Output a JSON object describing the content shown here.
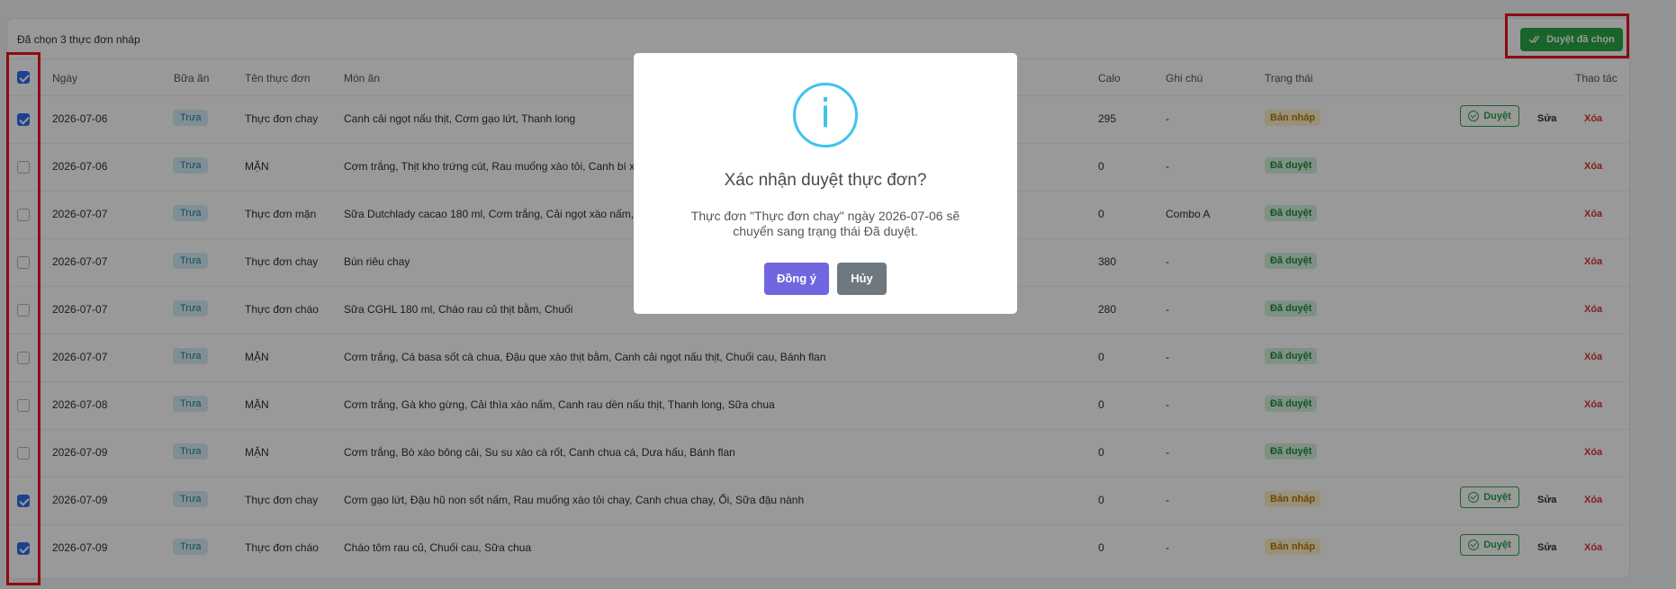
{
  "toolbar": {
    "selected_text": "Đã chọn 3 thực đơn nháp",
    "bulk_approve_label": "Duyệt đã chọn"
  },
  "table": {
    "headers": {
      "date": "Ngày",
      "meal": "Bữa ăn",
      "menu_name": "Tên thực đơn",
      "dishes": "Món ăn",
      "calories": "Calo",
      "note": "Ghi chú",
      "status": "Trạng thái",
      "actions": "Thao tác"
    },
    "action_labels": {
      "approve": "Duyệt",
      "edit": "Sửa",
      "delete": "Xóa"
    },
    "rows": [
      {
        "checked": true,
        "date": "2026-07-06",
        "meal": "Trưa",
        "menu_name": "Thực đơn chay",
        "dishes": "Canh cải ngọt nấu thịt, Cơm gạo lứt, Thanh long",
        "calories": "295",
        "note": "-",
        "status": "Bản nháp",
        "status_type": "draft"
      },
      {
        "checked": false,
        "date": "2026-07-06",
        "meal": "Trưa",
        "menu_name": "MẶN",
        "dishes": "Cơm trắng, Thịt kho trứng cút, Rau muống xào tỏi, Canh bí x",
        "calories": "0",
        "note": "-",
        "status": "Đã duyệt",
        "status_type": "approved"
      },
      {
        "checked": false,
        "date": "2026-07-07",
        "meal": "Trưa",
        "menu_name": "Thực đơn mặn",
        "dishes": "Sữa Dutchlady cacao 180 ml, Cơm trắng, Cải ngọt xào nấm,",
        "calories": "0",
        "note": "Combo A",
        "status": "Đã duyệt",
        "status_type": "approved"
      },
      {
        "checked": false,
        "date": "2026-07-07",
        "meal": "Trưa",
        "menu_name": "Thực đơn chay",
        "dishes": "Bún riêu chay",
        "calories": "380",
        "note": "-",
        "status": "Đã duyệt",
        "status_type": "approved"
      },
      {
        "checked": false,
        "date": "2026-07-07",
        "meal": "Trưa",
        "menu_name": "Thực đơn cháo",
        "dishes": "Sữa CGHL 180 ml, Cháo rau củ thịt bằm, Chuối",
        "calories": "280",
        "note": "-",
        "status": "Đã duyệt",
        "status_type": "approved"
      },
      {
        "checked": false,
        "date": "2026-07-07",
        "meal": "Trưa",
        "menu_name": "MẶN",
        "dishes": "Cơm trắng, Cá basa sốt cà chua, Đậu que xào thịt bằm, Canh cải ngọt nấu thịt, Chuối cau, Bánh flan",
        "calories": "0",
        "note": "-",
        "status": "Đã duyệt",
        "status_type": "approved"
      },
      {
        "checked": false,
        "date": "2026-07-08",
        "meal": "Trưa",
        "menu_name": "MẶN",
        "dishes": "Cơm trắng, Gà kho gừng, Cải thìa xào nấm, Canh rau dền nấu thịt, Thanh long, Sữa chua",
        "calories": "0",
        "note": "-",
        "status": "Đã duyệt",
        "status_type": "approved"
      },
      {
        "checked": false,
        "date": "2026-07-09",
        "meal": "Trưa",
        "menu_name": "MẶN",
        "dishes": "Cơm trắng, Bò xào bông cải, Su su xào cà rốt, Canh chua cá, Dưa hấu, Bánh flan",
        "calories": "0",
        "note": "-",
        "status": "Đã duyệt",
        "status_type": "approved"
      },
      {
        "checked": true,
        "date": "2026-07-09",
        "meal": "Trưa",
        "menu_name": "Thực đơn chay",
        "dishes": "Cơm gạo lứt, Đậu hũ non sốt nấm, Rau muống xào tỏi chay, Canh chua chay, Ổi, Sữa đậu nành",
        "calories": "0",
        "note": "-",
        "status": "Bản nháp",
        "status_type": "draft"
      },
      {
        "checked": true,
        "date": "2026-07-09",
        "meal": "Trưa",
        "menu_name": "Thực đơn cháo",
        "dishes": "Cháo tôm rau củ, Chuối cau, Sữa chua",
        "calories": "0",
        "note": "-",
        "status": "Bản nháp",
        "status_type": "draft"
      }
    ]
  },
  "modal": {
    "icon": "info-icon",
    "icon_glyph": "i",
    "title": "Xác nhận duyệt thực đơn?",
    "text": "Thực đơn \"Thực đơn chay\" ngày 2026-07-06 sẽ chuyển sang trạng thái Đã duyệt.",
    "confirm_label": "Đồng ý",
    "cancel_label": "Hủy"
  },
  "colors": {
    "accent_green": "#28a745",
    "highlight_red": "#e8141e",
    "confirm_purple": "#7066e0",
    "info_blue": "#3fc3ee"
  }
}
